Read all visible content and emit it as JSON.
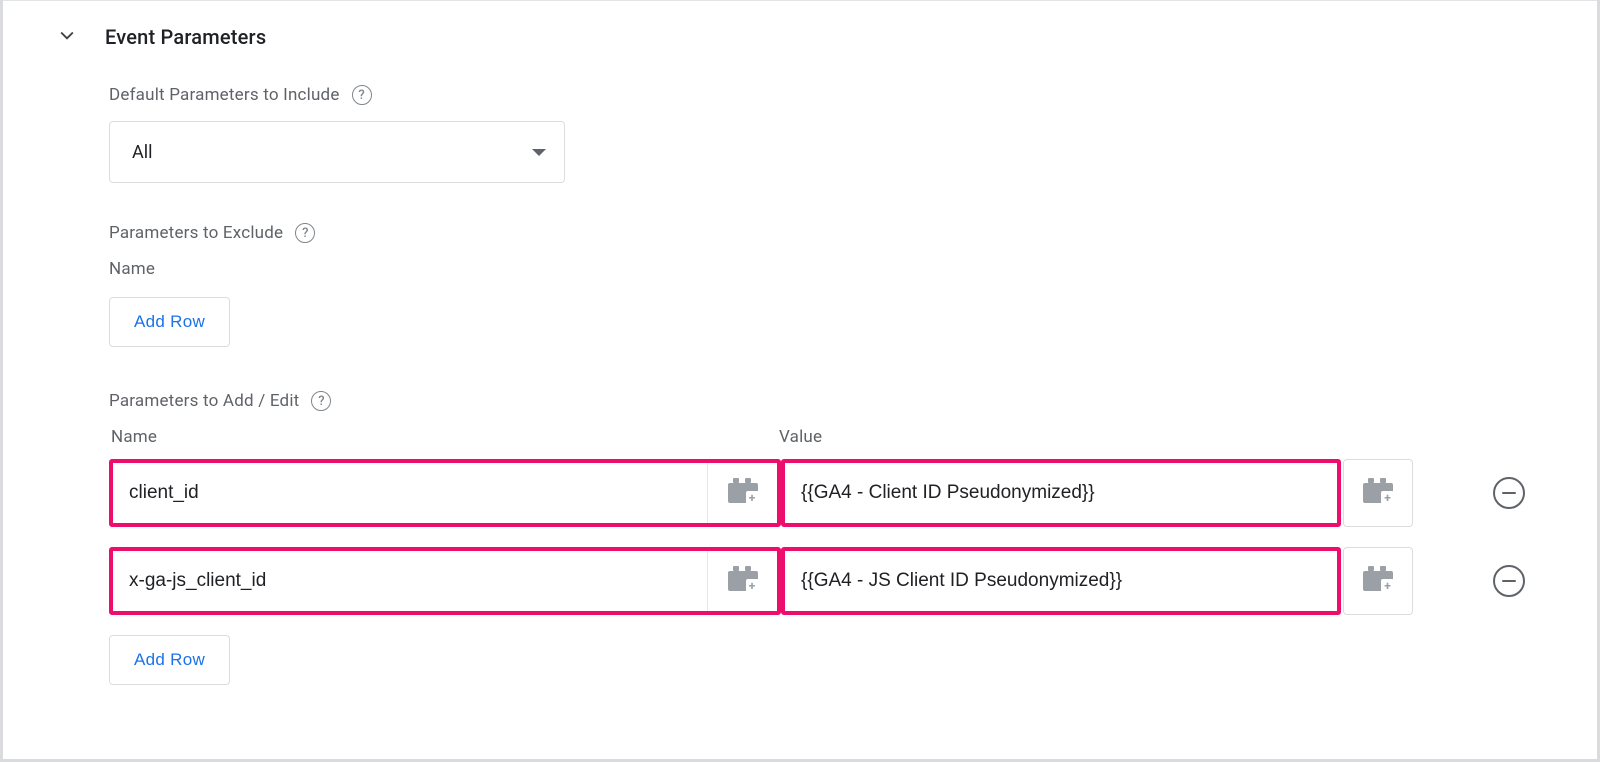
{
  "section": {
    "title": "Event Parameters",
    "default_params": {
      "label": "Default Parameters to Include",
      "selected": "All"
    },
    "exclude": {
      "label": "Parameters to Exclude",
      "col_name": "Name",
      "add_row": "Add Row"
    },
    "add_edit": {
      "label": "Parameters to Add / Edit",
      "col_name": "Name",
      "col_value": "Value",
      "rows": [
        {
          "name": "client_id",
          "value": "{{GA4 - Client ID Pseudonymized}}"
        },
        {
          "name": "x-ga-js_client_id",
          "value": "{{GA4 - JS Client ID Pseudonymized}}"
        }
      ],
      "add_row": "Add Row"
    }
  }
}
